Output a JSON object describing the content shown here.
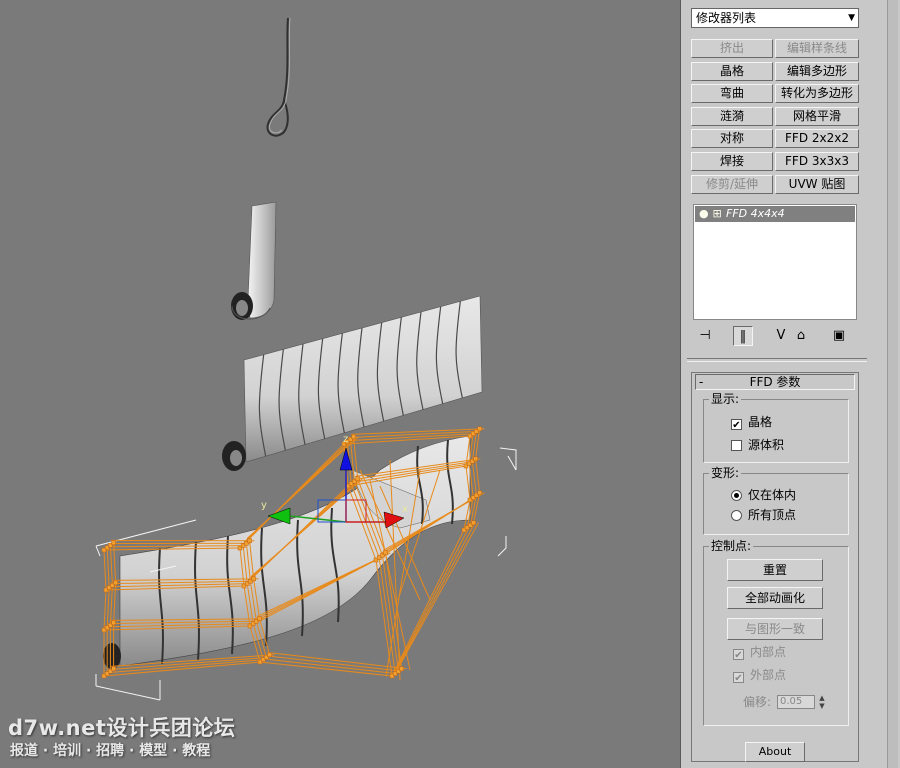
{
  "watermark": {
    "line1": "d7w.net设计兵团论坛",
    "line2": "报道 · 培训 · 招聘 · 模型 · 教程"
  },
  "viewport": {
    "gizmo": {
      "x_label": "x",
      "y_label": "y",
      "z_label": "z"
    }
  },
  "panel": {
    "modifier_list": "修改器列表",
    "buttons": [
      {
        "label": "挤出",
        "disabled": true
      },
      {
        "label": "编辑样条线",
        "disabled": true
      },
      {
        "label": "晶格",
        "disabled": false
      },
      {
        "label": "编辑多边形",
        "disabled": false
      },
      {
        "label": "弯曲",
        "disabled": false
      },
      {
        "label": "转化为多边形",
        "disabled": false
      },
      {
        "label": "涟漪",
        "disabled": false
      },
      {
        "label": "网格平滑",
        "disabled": false
      },
      {
        "label": "对称",
        "disabled": false
      },
      {
        "label": "FFD 2x2x2",
        "disabled": false
      },
      {
        "label": "焊接",
        "disabled": false
      },
      {
        "label": "FFD 3x3x3",
        "disabled": false
      },
      {
        "label": "修剪/延伸",
        "disabled": true
      },
      {
        "label": "UVW 贴图",
        "disabled": false
      }
    ],
    "stack_item": "FFD 4x4x4",
    "stack_icons": {
      "light": "lightbulb-icon",
      "expand": "plus-box-icon"
    },
    "toolbar_icons": [
      "pin-stack-icon",
      "show-end-result-icon",
      "make-unique-icon",
      "remove-modifier-icon",
      "configure-sets-icon"
    ]
  },
  "rollout": {
    "title": "FFD 参数",
    "collapse": "-",
    "display": {
      "label": "显示:",
      "lattice": {
        "label": "晶格",
        "checked": true
      },
      "source_volume": {
        "label": "源体积",
        "checked": false
      }
    },
    "deform": {
      "label": "变形:",
      "only_in_volume": {
        "label": "仅在体内",
        "selected": true
      },
      "all_vertices": {
        "label": "所有顶点",
        "selected": false
      }
    },
    "control_points": {
      "label": "控制点:",
      "reset": "重置",
      "animate_all": "全部动画化",
      "conform_to_shape": "与图形一致",
      "inside_points": {
        "label": "内部点",
        "checked": true
      },
      "outside_points": {
        "label": "外部点",
        "checked": true
      },
      "offset_label": "偏移:",
      "offset_value": "0.05"
    },
    "about": "About"
  }
}
